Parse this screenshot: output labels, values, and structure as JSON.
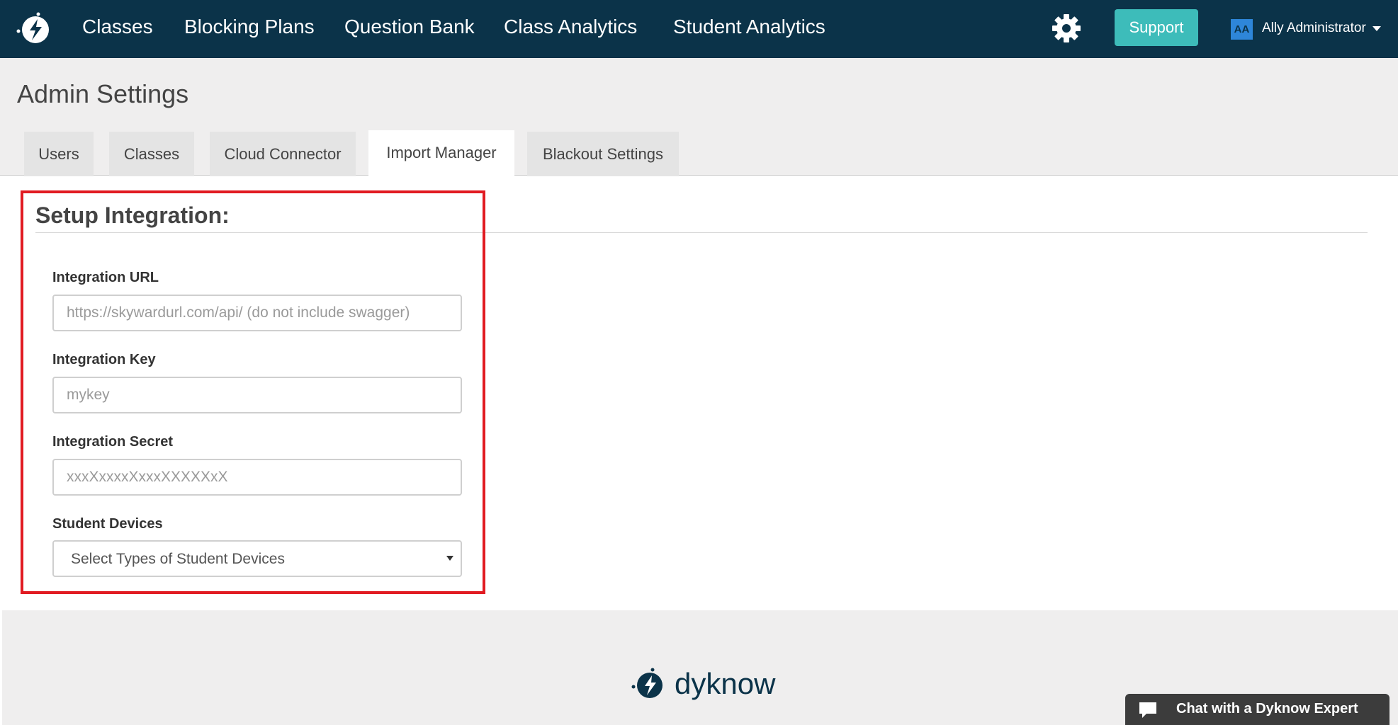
{
  "nav": {
    "links": [
      "Classes",
      "Blocking Plans",
      "Question Bank",
      "Class Analytics",
      "Student Analytics"
    ],
    "support_label": "Support",
    "user_initials": "AA",
    "user_name": "Ally Administrator"
  },
  "page": {
    "title": "Admin Settings",
    "tabs": [
      {
        "label": "Users",
        "active": false
      },
      {
        "label": "Classes",
        "active": false
      },
      {
        "label": "Cloud Connector",
        "active": false
      },
      {
        "label": "Import Manager",
        "active": true
      },
      {
        "label": "Blackout Settings",
        "active": false
      }
    ]
  },
  "setup": {
    "title": "Setup Integration:",
    "fields": [
      {
        "label": "Integration URL",
        "placeholder": "https://skywardurl.com/api/ (do not include swagger)",
        "value": ""
      },
      {
        "label": "Integration Key",
        "placeholder": "mykey",
        "value": ""
      },
      {
        "label": "Integration Secret",
        "placeholder": "xxxXxxxxXxxxXXXXXxX",
        "value": ""
      }
    ],
    "devices_label": "Student Devices",
    "devices_placeholder": "Select Types of Student Devices"
  },
  "footer": {
    "brand": "dyknow",
    "chat_label": "Chat with a Dyknow Expert"
  },
  "colors": {
    "nav_bg": "#0b3349",
    "support_bg": "#3dbcba",
    "highlight": "#e11b22",
    "chat_bg": "#3c3c3c"
  },
  "icons": {
    "logo": "dyknow-logo-icon",
    "settings": "gear-icon",
    "user_menu": "caret-down-icon",
    "chat": "chat-bubble-icon"
  }
}
